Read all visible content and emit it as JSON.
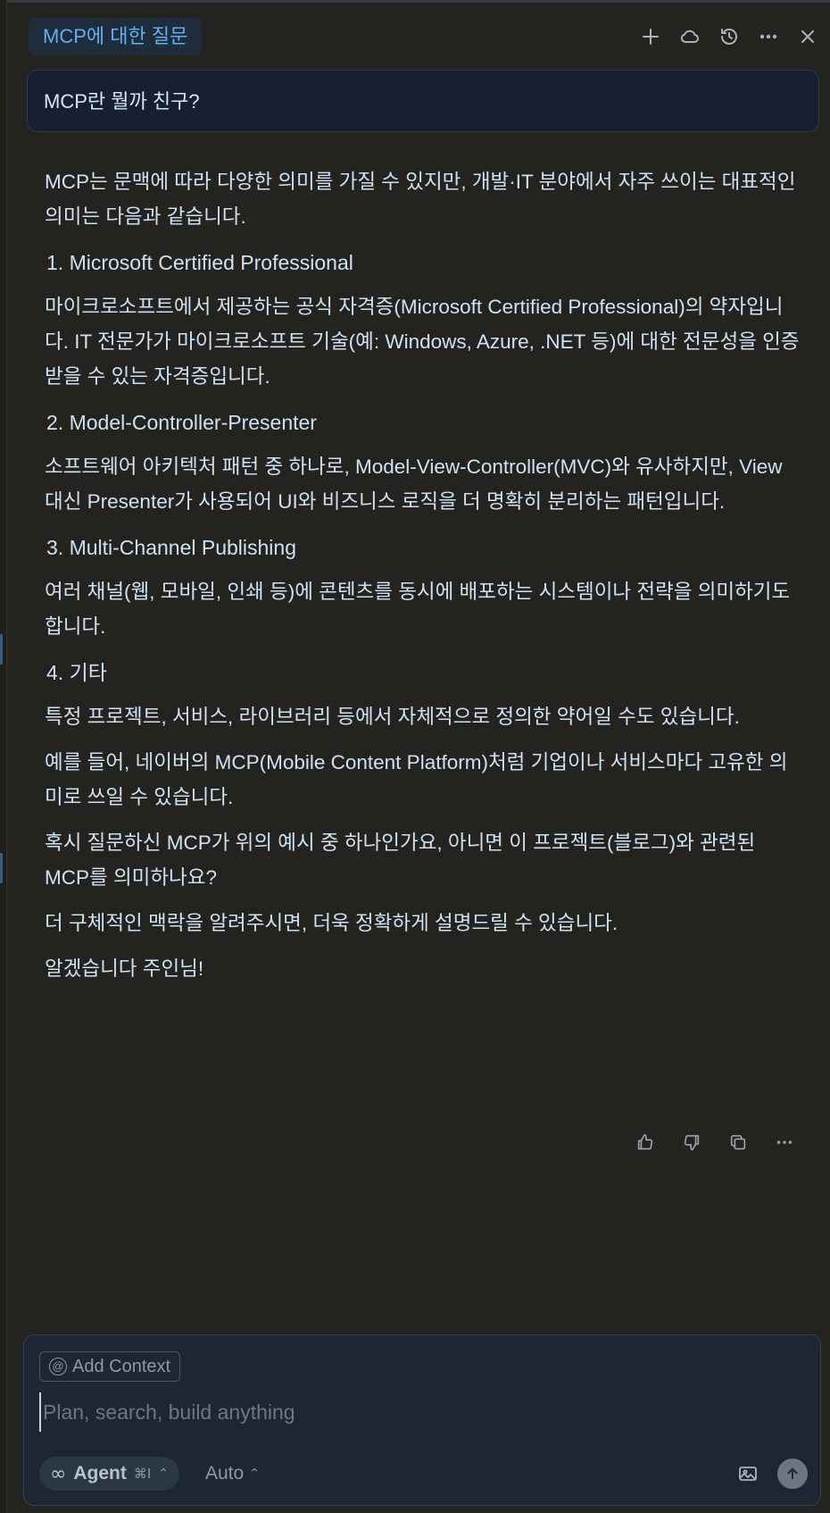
{
  "header": {
    "title": "MCP에 대한 질문",
    "actions": [
      "plus-icon",
      "cloud-icon",
      "history-icon",
      "more-icon",
      "close-icon"
    ]
  },
  "user_message": "MCP란 뭘까 친구?",
  "answer": {
    "intro": "MCP는 문맥에 따라 다양한 의미를 가질 수 있지만, 개발·IT 분야에서 자주 쓰이는 대표적인 의미는 다음과 같습니다.",
    "sections": [
      {
        "heading": "1. Microsoft Certified Professional",
        "body": "마이크로소프트에서 제공하는 공식 자격증(Microsoft Certified Professional)의 약자입니다. IT 전문가가 마이크로소프트 기술(예: Windows, Azure, .NET 등)에 대한 전문성을 인증받을 수 있는 자격증입니다."
      },
      {
        "heading": "2. Model-Controller-Presenter",
        "body": "소프트웨어 아키텍처 패턴 중 하나로, Model-View-Controller(MVC)와 유사하지만, View 대신 Presenter가 사용되어 UI와 비즈니스 로직을 더 명확히 분리하는 패턴입니다."
      },
      {
        "heading": "3. Multi-Channel Publishing",
        "body": "여러 채널(웹, 모바일, 인쇄 등)에 콘텐츠를 동시에 배포하는 시스템이나 전략을 의미하기도 합니다."
      },
      {
        "heading": "4. 기타",
        "body": "특정 프로젝트, 서비스, 라이브러리 등에서 자체적으로 정의한 약어일 수도 있습니다."
      }
    ],
    "example": "예를 들어, 네이버의 MCP(Mobile Content Platform)처럼 기업이나 서비스마다 고유한 의미로 쓰일 수 있습니다.",
    "question": "혹시 질문하신 MCP가 위의 예시 중 하나인가요, 아니면 이 프로젝트(블로그)와 관련된 MCP를 의미하나요?",
    "offer": "더 구체적인 맥락을 알려주시면, 더욱 정확하게 설명드릴 수 있습니다.",
    "closing": "알겠습니다 주인님!"
  },
  "feedback_actions": [
    "thumbs-up-icon",
    "thumbs-down-icon",
    "copy-icon",
    "more-icon"
  ],
  "composer": {
    "add_context_label": "Add Context",
    "placeholder": "Plan, search, build anything",
    "value": "",
    "agent_label": "Agent",
    "agent_shortcut": "⌘I",
    "mode_label": "Auto"
  },
  "colors": {
    "background": "#24231f",
    "accent": "#5fb0f0",
    "text": "#cfe2f3",
    "composer_bg": "#1d2733"
  }
}
